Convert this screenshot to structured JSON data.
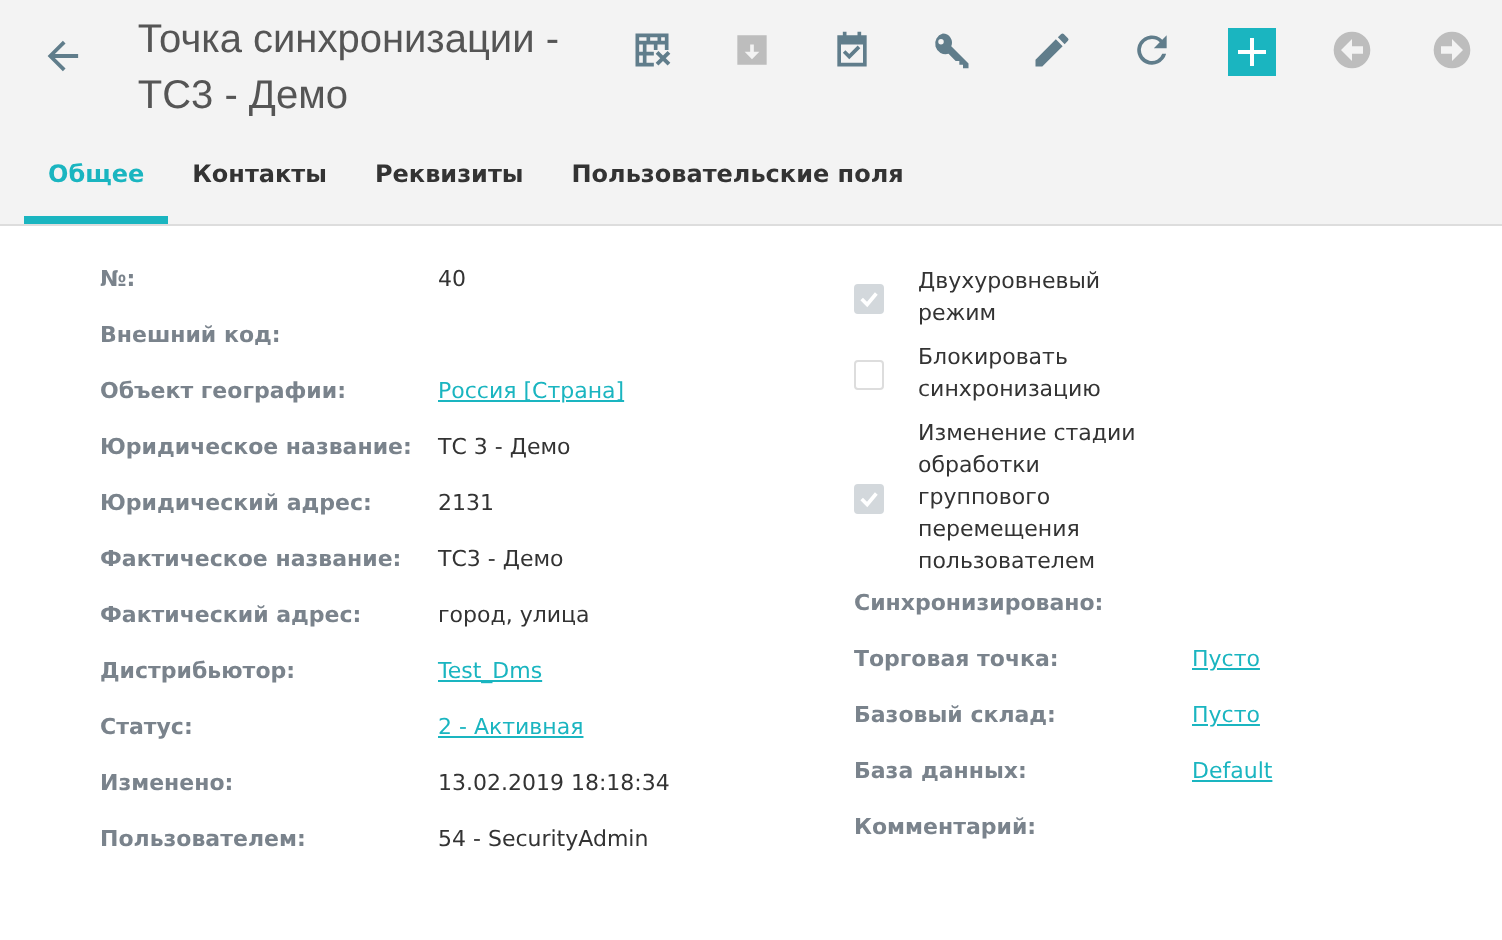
{
  "header": {
    "title": "Точка синхронизации - ТС3 - Демо",
    "toolbar": [
      {
        "kind": "table-x",
        "disabled": false
      },
      {
        "kind": "archive",
        "disabled": true
      },
      {
        "kind": "calendar-check",
        "disabled": false
      },
      {
        "kind": "key",
        "disabled": false
      },
      {
        "kind": "pencil",
        "disabled": false
      },
      {
        "kind": "refresh",
        "disabled": false
      },
      {
        "kind": "add",
        "disabled": false
      },
      {
        "kind": "prev",
        "disabled": true
      },
      {
        "kind": "next",
        "disabled": true
      }
    ]
  },
  "tabs": [
    {
      "label": "Общее",
      "selected": true
    },
    {
      "label": "Контакты",
      "selected": false
    },
    {
      "label": "Реквизиты",
      "selected": false
    },
    {
      "label": "Пользовательские поля",
      "selected": false
    }
  ],
  "left_fields": [
    {
      "label": "№:",
      "value": "40",
      "kind": "text"
    },
    {
      "label": "Внешний код:"
    },
    {
      "label": "Объект географии:",
      "value": "Россия [Страна]",
      "kind": "link"
    },
    {
      "label": "Юридическое название:",
      "value": "ТС 3 - Демо",
      "kind": "text"
    },
    {
      "label": "Юридический адрес:",
      "value": "2131",
      "kind": "text"
    },
    {
      "label": "Фактическое название:",
      "value": "ТС3 - Демо",
      "kind": "text"
    },
    {
      "label": "Фактический адрес:",
      "value": "город, улица",
      "kind": "text"
    },
    {
      "label": "Дистрибьютор:",
      "value": "Test_Dms",
      "kind": "link"
    },
    {
      "label": "Статус:",
      "value": "2 - Активная",
      "kind": "link"
    },
    {
      "label": "Изменено:",
      "value": "13.02.2019 18:18:34",
      "kind": "text"
    },
    {
      "label": "Пользователем:",
      "value": "54 - SecurityAdmin",
      "kind": "text"
    }
  ],
  "checkboxes": [
    {
      "label": "Двухуровневый режим",
      "checked": true
    },
    {
      "label": "Блокировать синхронизацию",
      "checked": false
    },
    {
      "label": "Изменение стадии обработки группового перемещения пользователем",
      "checked": true
    }
  ],
  "right_fields": [
    {
      "label": "Синхронизировано:"
    },
    {
      "label": "Торговая точка:",
      "value": "Пусто",
      "kind": "link"
    },
    {
      "label": "Базовый склад:",
      "value": "Пусто",
      "kind": "link"
    },
    {
      "label": "База данных:",
      "value": "Default",
      "kind": "link"
    },
    {
      "label": "Комментарий:"
    }
  ]
}
